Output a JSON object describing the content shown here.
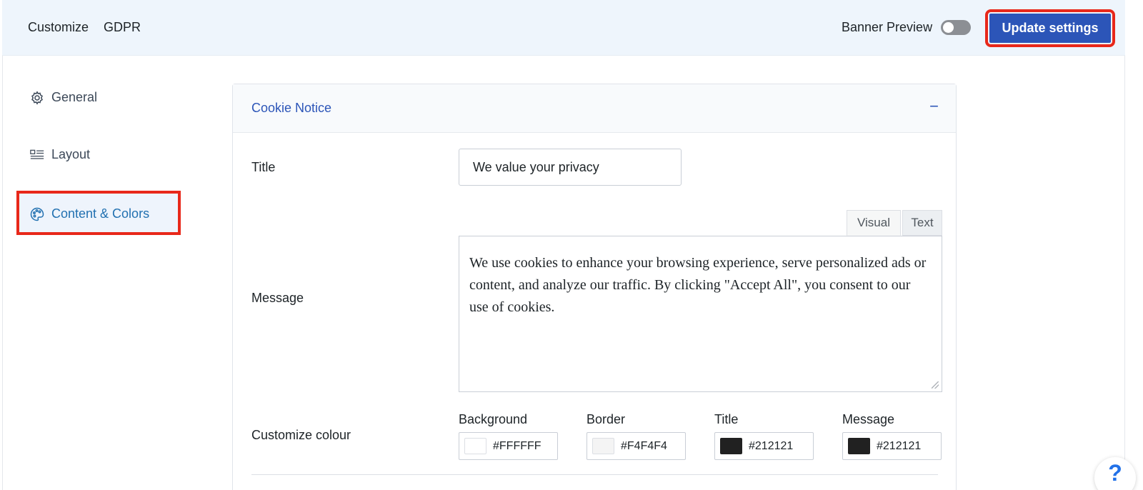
{
  "header": {
    "breadcrumb": [
      "Customize",
      "GDPR"
    ],
    "banner_preview_label": "Banner Preview",
    "banner_preview_on": false,
    "update_button": "Update settings"
  },
  "sidebar": {
    "items": [
      {
        "label": "General",
        "icon": "gear-icon",
        "active": false
      },
      {
        "label": "Layout",
        "icon": "layout-icon",
        "active": false
      },
      {
        "label": "Content & Colors",
        "icon": "palette-icon",
        "active": true
      }
    ]
  },
  "panel": {
    "title": "Cookie Notice",
    "collapse_symbol": "−",
    "fields": {
      "title_label": "Title",
      "title_value": "We value your privacy",
      "message_label": "Message",
      "message_tabs": [
        "Visual",
        "Text"
      ],
      "message_value": "We use cookies to enhance your browsing experience, serve personalized ads or content, and analyze our traffic. By clicking \"Accept All\", you consent to our use of cookies.",
      "colour_label": "Customize colour",
      "colours": [
        {
          "label": "Background",
          "value": "#FFFFFF",
          "swatch": "#FFFFFF"
        },
        {
          "label": "Border",
          "value": "#F4F4F4",
          "swatch": "#F4F4F4"
        },
        {
          "label": "Title",
          "value": "#212121",
          "swatch": "#212121"
        },
        {
          "label": "Message",
          "value": "#212121",
          "swatch": "#212121"
        }
      ]
    }
  },
  "help": {
    "symbol": "?"
  },
  "colors": {
    "accent": "#2c55b8",
    "highlight": "#e8281a",
    "header_bg": "#eef5fc"
  }
}
